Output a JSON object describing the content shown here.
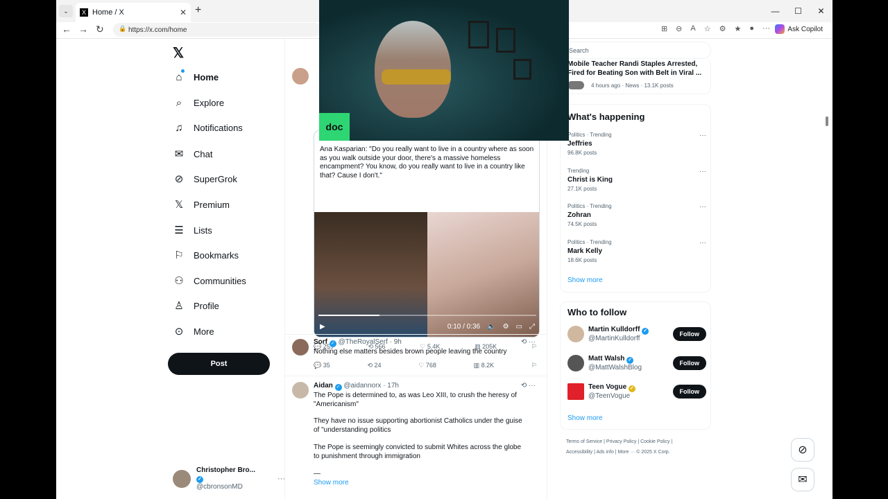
{
  "browser": {
    "tab_title": "Home / X",
    "url": "https://x.com/home",
    "copilot_label": "Ask Copilot"
  },
  "nav": {
    "items": [
      {
        "label": "Home",
        "icon": "home-icon"
      },
      {
        "label": "Explore",
        "icon": "search-icon"
      },
      {
        "label": "Notifications",
        "icon": "bell-icon"
      },
      {
        "label": "Chat",
        "icon": "mail-icon"
      },
      {
        "label": "SuperGrok",
        "icon": "grok-icon"
      },
      {
        "label": "Premium",
        "icon": "x-icon"
      },
      {
        "label": "Lists",
        "icon": "list-icon"
      },
      {
        "label": "Bookmarks",
        "icon": "bookmark-icon"
      },
      {
        "label": "Communities",
        "icon": "people-icon"
      },
      {
        "label": "Profile",
        "icon": "person-icon"
      },
      {
        "label": "More",
        "icon": "more-circle-icon"
      }
    ],
    "post_label": "Post",
    "me_name": "Christopher Bro...",
    "me_handle": "@cbronsonMD"
  },
  "feed": {
    "post1": {
      "quote_text": "Ana Kasparian: \"Do you really want to live in a country where as soon as you walk outside your door, there's a massive homeless encampment? You know, do you really want to live in a country like that? Cause I don't.\"",
      "video_time": "0:10 / 0:36",
      "progress": 0.28,
      "replies": "259",
      "reposts": "566",
      "likes": "5.4K",
      "views": "205K"
    },
    "post2": {
      "name": "Sorf",
      "handle": "@TheRoyalSerf",
      "time": "· 9h",
      "text": "Nothing else matters besides brown people leaving the country",
      "replies": "35",
      "reposts": "24",
      "likes": "768",
      "views": "8.2K"
    },
    "post3": {
      "name": "Aidan",
      "handle": "@aidannorx",
      "time": "· 17h",
      "p1": "The Pope is determined to, as was Leo XIII, to crush the heresy of \"Americanism\"",
      "p2": "They have no issue supporting abortionist Catholics under the guise of \"understanding politics",
      "p3": "The Pope is seemingly convicted to submit Whites across the globe to punishment through immigration",
      "p4": "—",
      "show_more": "Show more"
    }
  },
  "sidebar": {
    "search_placeholder": "Search",
    "news_title": "Mobile Teacher Randi Staples Arrested, Fired for Beating Son with Belt in Viral ...",
    "news_meta": "4 hours ago · News · 13.1K posts",
    "happening_title": "What's happening",
    "trends": [
      {
        "context": "Politics · Trending",
        "topic": "Jeffries",
        "count": "96.8K posts"
      },
      {
        "context": "Trending",
        "topic": "Christ is King",
        "count": "27.1K posts"
      },
      {
        "context": "Politics · Trending",
        "topic": "Zohran",
        "count": "74.5K posts"
      },
      {
        "context": "Politics · Trending",
        "topic": "Mark Kelly",
        "count": "18.6K posts"
      }
    ],
    "show_more": "Show more",
    "wtf_title": "Who to follow",
    "follow_label": "Follow",
    "wtf": [
      {
        "name": "Martin Kulldorff",
        "handle": "@MartinKulldorff"
      },
      {
        "name": "Matt Walsh",
        "handle": "@MattWalshBlog"
      },
      {
        "name": "Teen Vogue",
        "handle": "@TeenVogue"
      }
    ],
    "footer_line1": "Terms of Service  |  Privacy Policy  |  Cookie Policy  |",
    "footer_line2": "Accessibility  |  Ads info  |  More ···  © 2025 X Corp."
  },
  "overlay": {
    "badge": "doc"
  },
  "colors": {
    "accent": "#1d9bf0",
    "text": "#0f1419",
    "muted": "#536471",
    "overlay_badge": "#2ed573"
  }
}
